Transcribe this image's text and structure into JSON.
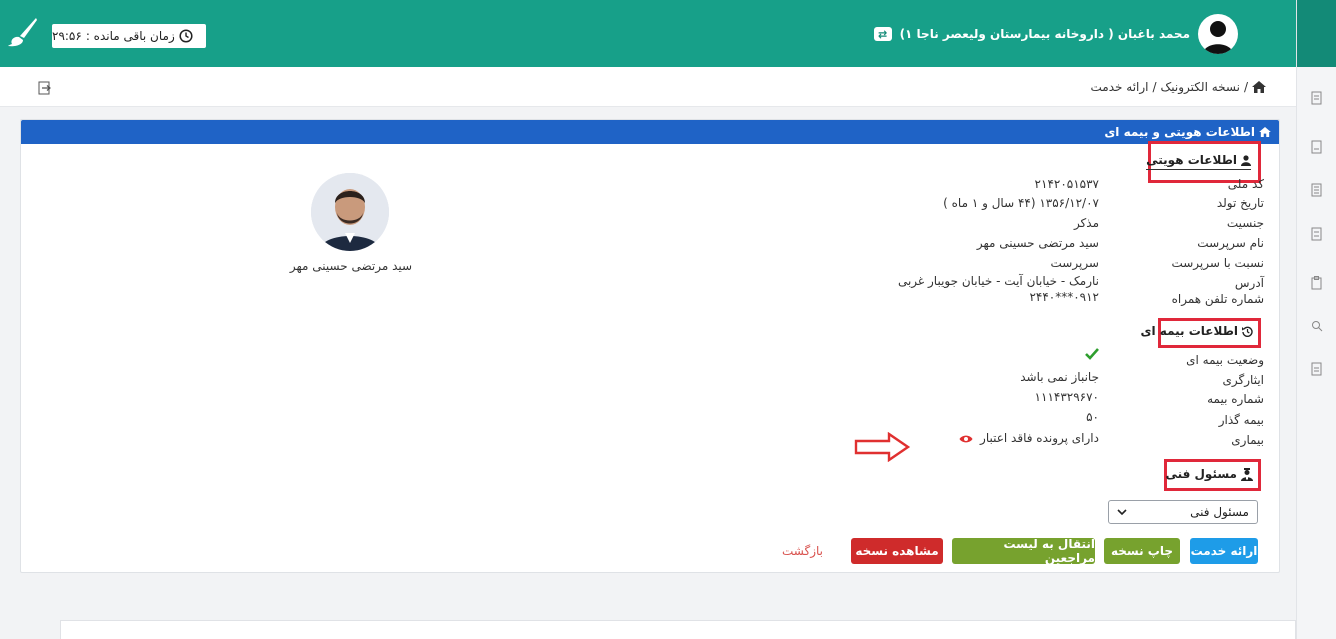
{
  "header": {
    "timer_label": "زمان باقی مانده :",
    "timer_value": "۲۹:۵۶",
    "user_name": "محمد باغبان ( داروخانه بیمارستان ولیعصر ناجا ۱)"
  },
  "breadcrumb": {
    "root": "نسخه الکترونیک",
    "separator": "/",
    "current": "ارائه خدمت"
  },
  "card": {
    "title": "اطلاعات هویتی و بیمه ای"
  },
  "identity": {
    "section_title": "اطلاعات هویتی",
    "rows": [
      {
        "label": "کد ملی",
        "value": "۲۱۴۲۰۵۱۵۳۷"
      },
      {
        "label": "تاریخ تولد",
        "value": "۱۳۵۶/۱۲/۰۷ (۴۴ سال و ۱ ماه )"
      },
      {
        "label": "جنسیت",
        "value": "مذکر"
      },
      {
        "label": "نام سرپرست",
        "value": "سید مرتضی حسینی مهر"
      },
      {
        "label": "نسبت با سرپرست",
        "value": "سرپرست"
      },
      {
        "label": "آدرس",
        "value": "نارمک - خیابان آیت - خیابان جویبار غربی"
      },
      {
        "label": "شماره تلفن همراه",
        "value": "۰۹۱۲***۲۴۴۰"
      }
    ],
    "photo_caption": "سید مرتضی حسینی مهر"
  },
  "insurance": {
    "section_title": "اطلاعات بیمه ای",
    "rows": [
      {
        "label": "وضعیت بیمه ای",
        "value": ""
      },
      {
        "label": "ایثارگری",
        "value": "جانباز نمی باشد"
      },
      {
        "label": "شماره بیمه",
        "value": "۱۱۱۴۳۲۹۶۷۰"
      },
      {
        "label": "بیمه گذار",
        "value": "۵۰"
      },
      {
        "label": "بیماری",
        "value": "دارای پرونده فاقد اعتبار"
      }
    ]
  },
  "technical": {
    "section_title": "مسئول فنی",
    "select_value": "مسئول فنی"
  },
  "buttons": {
    "provide_service": "ارائه خدمت",
    "print": "چاپ نسخه",
    "transfer": "انتقال به لیست مراجعین",
    "view": "مشاهده نسخه",
    "back": "بازگشت"
  },
  "colors": {
    "header_bg": "#17a089",
    "card_header_bg": "#1f63c6",
    "highlight_red": "#e0283a",
    "success_green": "#2e9e2e"
  },
  "icons": [
    "brush-icon",
    "clock-icon",
    "user-avatar-icon",
    "swap-icon",
    "home-icon",
    "exit-icon",
    "user-icon",
    "history-icon",
    "engineer-icon",
    "check-icon",
    "eye-icon",
    "arrow-right-icon",
    "chevron-down-icon"
  ]
}
